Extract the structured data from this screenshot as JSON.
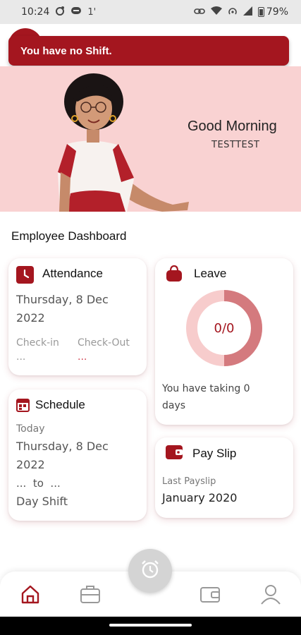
{
  "status_bar": {
    "time": "10:24",
    "notif_icon_1": "camera-icon",
    "notif_icon_2": "alarm-icon",
    "notif_icon_3": "1'",
    "battery": "79%"
  },
  "toast": {
    "message": "You have no Shift."
  },
  "hero": {
    "greeting": "Good Morning",
    "username": "TESTTEST"
  },
  "dashboard": {
    "title": "Employee Dashboard"
  },
  "attendance": {
    "title": "Attendance",
    "date_line1": "Thursday, 8 Dec",
    "date_line2": "2022",
    "checkin_label": "Check-in",
    "checkout_label": "Check-Out",
    "checkin_value": "...",
    "checkout_value": "..."
  },
  "leave": {
    "title": "Leave",
    "ratio": "0/0",
    "taken_fraction": 0.5,
    "text_line1": "You have taking 0",
    "text_line2": "days"
  },
  "schedule": {
    "title": "Schedule",
    "today_label": "Today",
    "date_line1": "Thursday, 8 Dec",
    "date_line2": "2022",
    "time_range": "...  to  ...",
    "shift_name": "Day Shift"
  },
  "payslip": {
    "title": "Pay Slip",
    "last_label": "Last Payslip",
    "period": "January 2020"
  },
  "colors": {
    "primary": "#a4161f",
    "hero_bg": "#f9d2d2",
    "donut_light": "#f7cccc",
    "donut_dark": "#d47a7e"
  },
  "nav": {
    "home": "home-icon",
    "work": "briefcase-icon",
    "wallet": "wallet-icon",
    "profile": "profile-icon",
    "center": "alarm-clock-icon"
  }
}
